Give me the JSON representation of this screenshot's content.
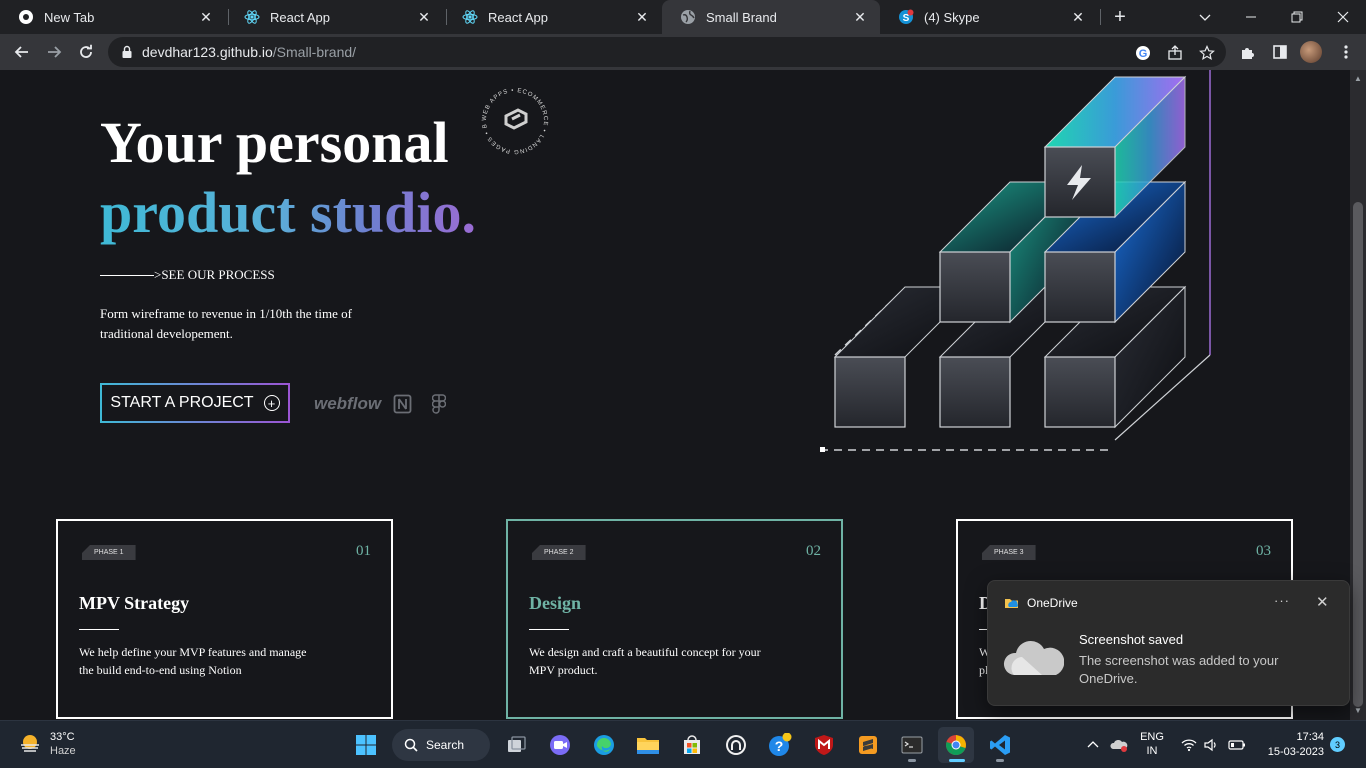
{
  "browser": {
    "tabs": [
      {
        "title": "New Tab",
        "icon": "chrome-icon"
      },
      {
        "title": "React App",
        "icon": "react-icon"
      },
      {
        "title": "React App",
        "icon": "react-icon"
      },
      {
        "title": "Small Brand",
        "icon": "globe-icon",
        "active": true
      },
      {
        "title": "(4) Skype",
        "icon": "skype-icon"
      }
    ],
    "url_host": "devdhar123.github.io",
    "url_path": "/Small-brand/"
  },
  "hero": {
    "title_line1": "Your personal",
    "title_line2": "product studio.",
    "badge_text": "WEB APPS • ECOMMERCE • LANDING PAGES • BLOGS •",
    "process_link": ">SEE OUR PROCESS",
    "description": "Form wireframe to revenue in 1/10th the time of traditional developement.",
    "cta_label": "START A PROJECT",
    "tool_webflow": "webflow",
    "accent_gradient": [
      "#3fb9d6",
      "#9b55d4"
    ]
  },
  "phases": [
    {
      "tag": "PHASE 1",
      "num": "01",
      "title": "MPV Strategy",
      "desc": "We help define your MVP features and manage the build end-to-end using Notion"
    },
    {
      "tag": "PHASE 2",
      "num": "02",
      "title": "Design",
      "desc": "We design and craft a beautiful concept for your MPV product."
    },
    {
      "tag": "PHASE 3",
      "num": "03",
      "title": "D",
      "desc": "W\npl"
    }
  ],
  "toast": {
    "app": "OneDrive",
    "more": "···",
    "title": "Screenshot saved",
    "body": "The screenshot was added to your OneDrive."
  },
  "taskbar": {
    "temperature": "33°C",
    "weather": "Haze",
    "search": "Search",
    "lang_line1": "ENG",
    "lang_line2": "IN",
    "time": "17:34",
    "date": "15-03-2023",
    "notifications": "3"
  }
}
